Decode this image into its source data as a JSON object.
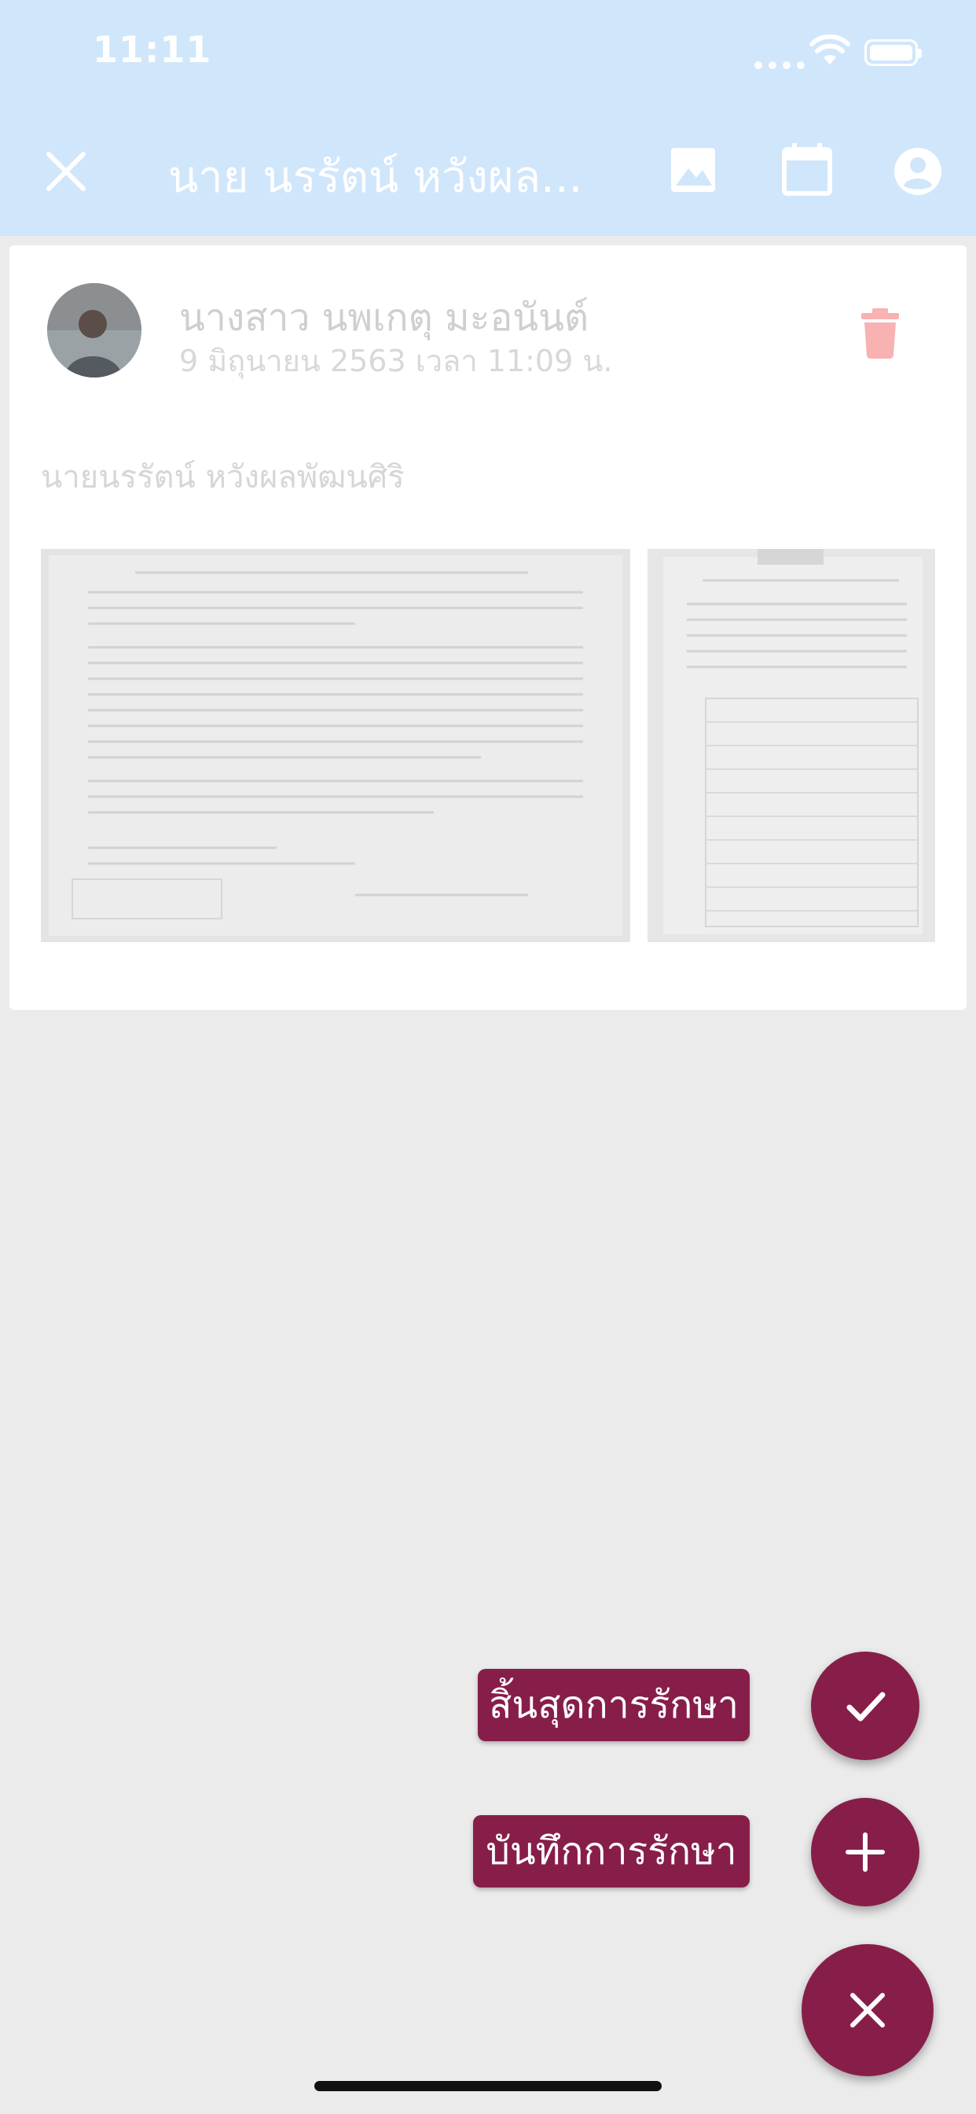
{
  "status_bar": {
    "time": "11:11"
  },
  "header": {
    "title": "นาย นรรัตน์ หวังผล..."
  },
  "post": {
    "author": "นางสาว นพเกตุ มะอนันต์",
    "timestamp": "9 มิถุนายน 2563 เวลา 11:09 น.",
    "patient": "นายนรรัตน์  หวังผลพัฒนศิริ"
  },
  "fab_menu": {
    "end_treatment_label": "สิ้นสุดการรักษา",
    "record_treatment_label": "บันทึกการรักษา"
  },
  "colors": {
    "accent": "#871e4a",
    "topbar": "#d0e6fb",
    "delete": "#f8b2b2"
  }
}
